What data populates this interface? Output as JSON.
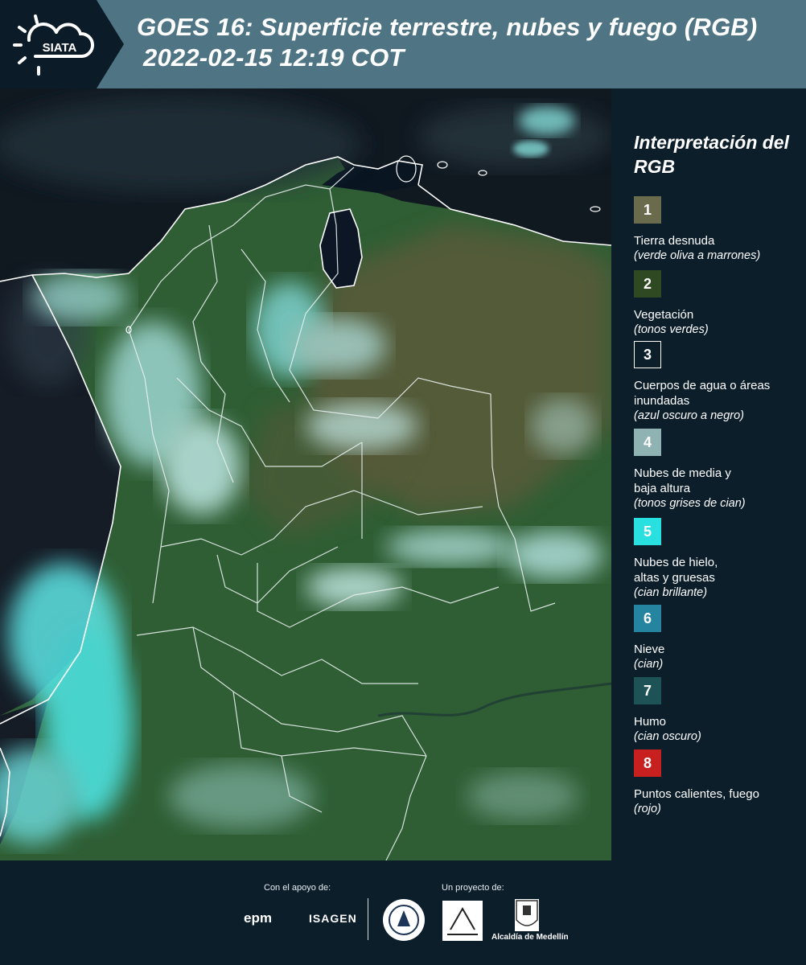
{
  "header": {
    "title_line1": "GOES 16: Superficie terrestre, nubes y fuego (RGB)",
    "title_line2": "2022-02-15 12:19 COT",
    "logo_text": "SIATA"
  },
  "legend": {
    "title": "Interpretación del RGB",
    "items": [
      {
        "number": "1",
        "label": "Tierra desnuda",
        "desc": "(verde oliva a marrones)",
        "color": "#6a6a4c"
      },
      {
        "number": "2",
        "label": "Vegetación",
        "desc": "(tonos verdes)",
        "color": "#2f4a22"
      },
      {
        "number": "3",
        "label": "Cuerpos de agua o áreas inundadas",
        "desc": "(azul oscuro a negro)",
        "color": "#0d1e2b"
      },
      {
        "number": "4",
        "label": "Nubes de media y baja altura",
        "desc": "(tonos grises de cian)",
        "color": "#8fb3b3"
      },
      {
        "number": "5",
        "label": "Nubes de hielo, altas y gruesas",
        "desc": "(cian brillante)",
        "color": "#29e0e0"
      },
      {
        "number": "6",
        "label": "Nieve",
        "desc": "(cian)",
        "color": "#2585a0"
      },
      {
        "number": "7",
        "label": "Humo",
        "desc": "(cian oscuro)",
        "color": "#1d5257"
      },
      {
        "number": "8",
        "label": "Puntos calientes, fuego",
        "desc": "(rojo)",
        "color": "#c81f1f"
      }
    ]
  },
  "footer": {
    "support_label": "Con el apoyo de:",
    "project_label": "Un proyecto de:",
    "sponsor_epm": "epm",
    "sponsor_isagen": "ISAGEN",
    "medellin_label": "Alcaldía de Medellín"
  }
}
